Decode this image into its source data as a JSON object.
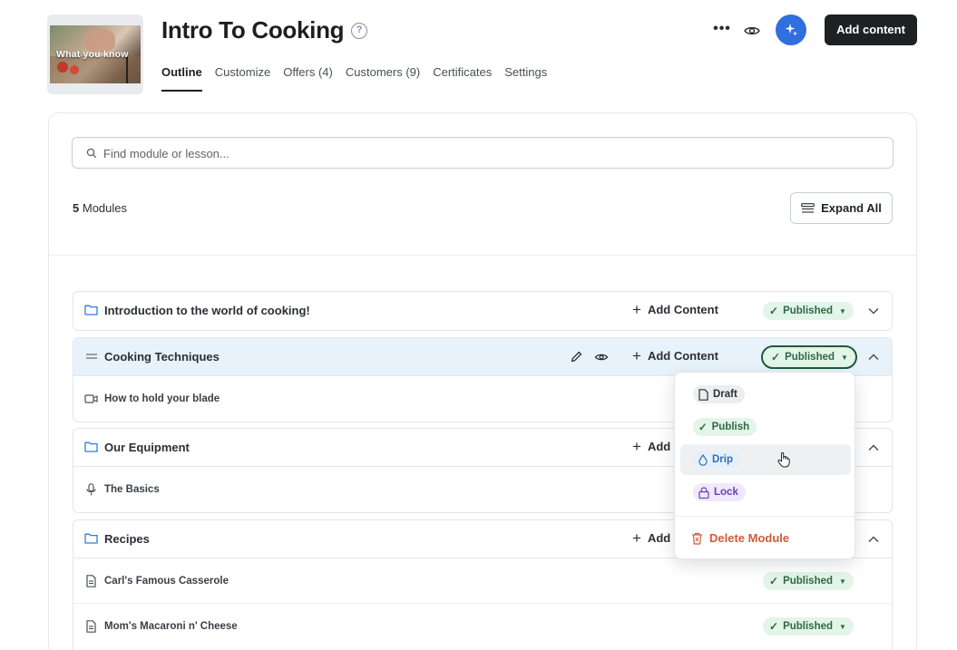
{
  "header": {
    "thumbnail_caption": "What you know",
    "title": "Intro To Cooking",
    "help_icon": "?",
    "more_icon": "•••",
    "add_content_label": "Add content",
    "tabs": [
      {
        "label": "Outline",
        "active": true
      },
      {
        "label": "Customize",
        "active": false
      },
      {
        "label": "Offers (4)",
        "active": false
      },
      {
        "label": "Customers (9)",
        "active": false
      },
      {
        "label": "Certificates",
        "active": false
      },
      {
        "label": "Settings",
        "active": false
      }
    ]
  },
  "search": {
    "placeholder": "Find module or lesson..."
  },
  "toolbar": {
    "modules_count": "5",
    "modules_label": "Modules",
    "expand_all_label": "Expand All"
  },
  "modules": [
    {
      "title": "Introduction to the world of cooking!",
      "add_label": "Add Content",
      "status": "Published",
      "expanded": false,
      "lessons": []
    },
    {
      "title": "Cooking Techniques",
      "add_label": "Add Content",
      "status": "Published",
      "expanded": true,
      "active": true,
      "lessons": [
        {
          "title": "How to hold your blade",
          "type": "video"
        }
      ]
    },
    {
      "title": "Our Equipment",
      "add_label": "Add",
      "expanded": true,
      "lessons": [
        {
          "title": "The Basics",
          "type": "audio"
        }
      ]
    },
    {
      "title": "Recipes",
      "add_label": "Add",
      "expanded": true,
      "lessons": [
        {
          "title": "Carl's Famous Casserole",
          "type": "document",
          "status": "Published"
        },
        {
          "title": "Mom's Macaroni n' Cheese",
          "type": "document",
          "status": "Published"
        }
      ]
    }
  ],
  "status_menu": {
    "options": [
      {
        "label": "Draft",
        "icon": "page-icon"
      },
      {
        "label": "Publish",
        "icon": "check-icon"
      },
      {
        "label": "Drip",
        "icon": "drop-icon",
        "hovered": true
      },
      {
        "label": "Lock",
        "icon": "lock-icon"
      }
    ],
    "delete_label": "Delete Module"
  },
  "colors": {
    "accent_blue": "#2f6fde",
    "published_bg": "#e3f4e8",
    "published_text": "#2d6a43",
    "delete_text": "#d05a3a",
    "active_row_bg": "#e7f2fb"
  }
}
